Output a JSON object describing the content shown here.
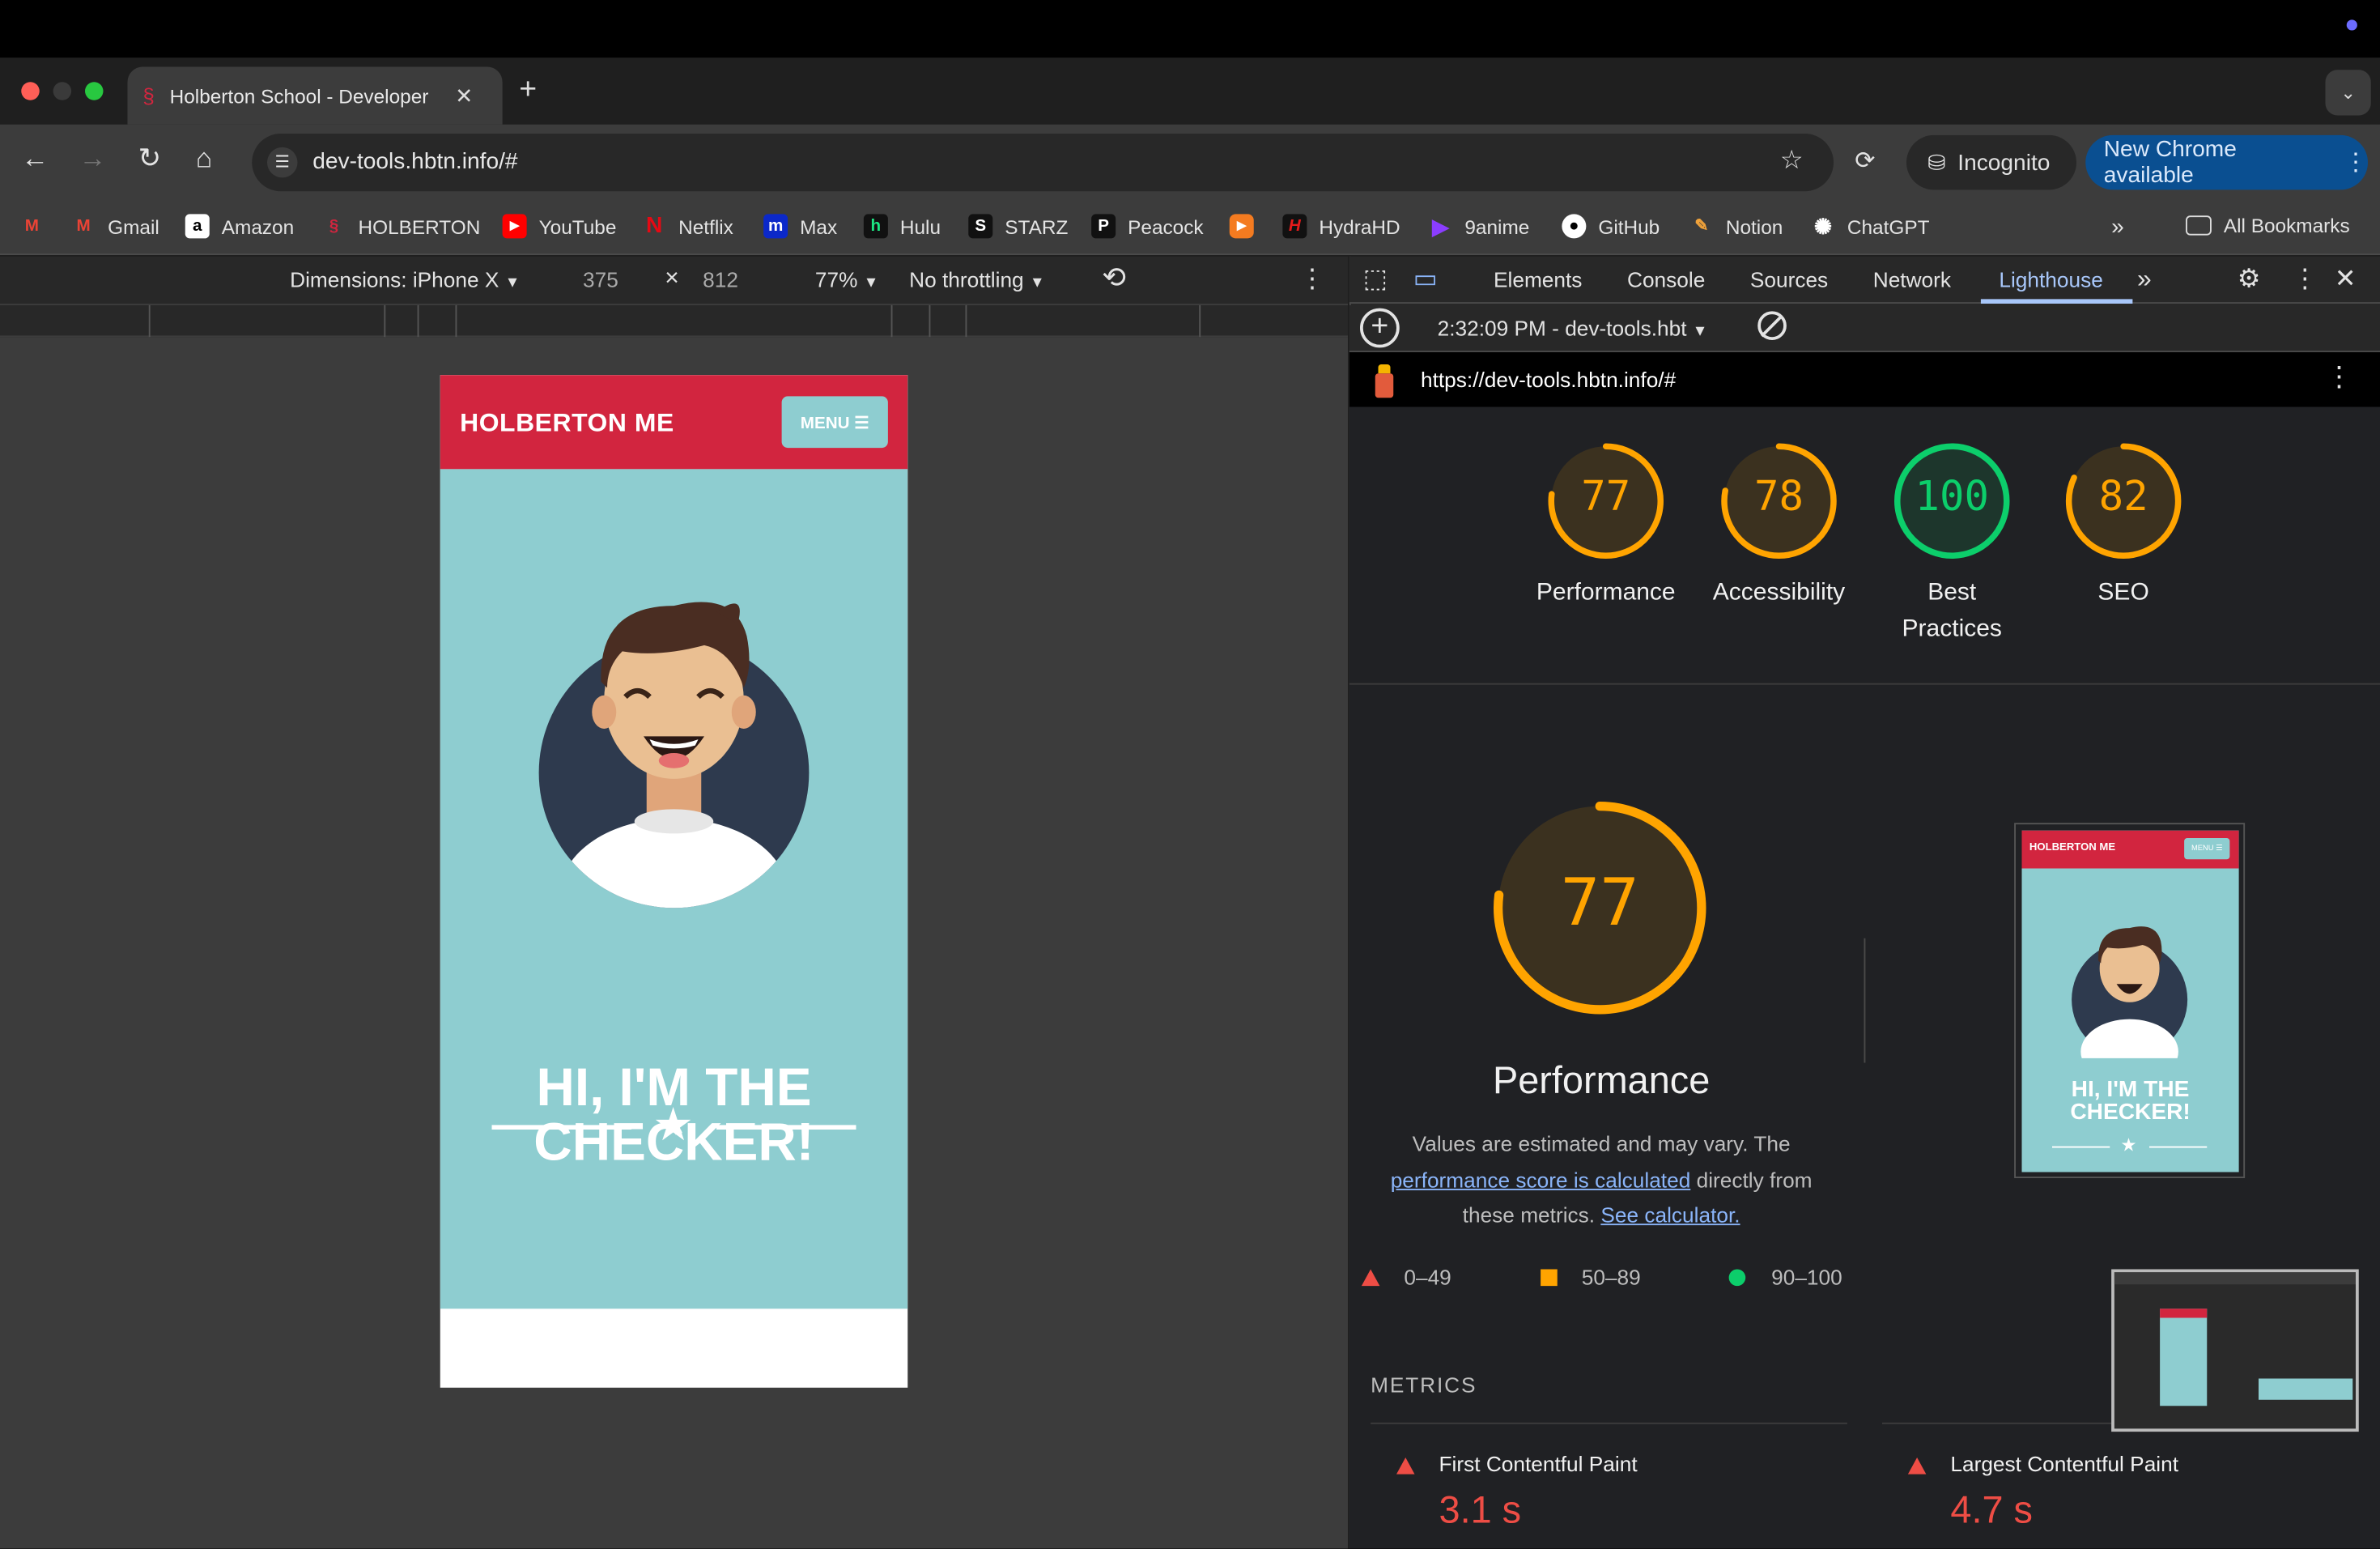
{
  "browser": {
    "tab_title": "Holberton School - Developer",
    "url": "dev-tools.hbtn.info/#",
    "incognito_label": "Incognito",
    "update_label": "New Chrome available",
    "bookmarks": [
      {
        "label": "",
        "icon": "gmail-icon"
      },
      {
        "label": "Gmail",
        "icon": "gmail-icon"
      },
      {
        "label": "Amazon",
        "icon": "amazon-icon"
      },
      {
        "label": "HOLBERTON",
        "icon": "holberton-icon"
      },
      {
        "label": "YouTube",
        "icon": "youtube-icon"
      },
      {
        "label": "Netflix",
        "icon": "netflix-icon"
      },
      {
        "label": "Max",
        "icon": "max-icon"
      },
      {
        "label": "Hulu",
        "icon": "hulu-icon"
      },
      {
        "label": "STARZ",
        "icon": "starz-icon"
      },
      {
        "label": "Peacock",
        "icon": "peacock-icon"
      },
      {
        "label": "",
        "icon": "play-icon"
      },
      {
        "label": "HydraHD",
        "icon": "hydra-icon"
      },
      {
        "label": "9anime",
        "icon": "anime-icon"
      },
      {
        "label": "GitHub",
        "icon": "github-icon"
      },
      {
        "label": "Notion",
        "icon": "notion-icon"
      },
      {
        "label": "ChatGPT",
        "icon": "chatgpt-icon"
      }
    ],
    "all_bookmarks": "All Bookmarks"
  },
  "device_toolbar": {
    "dimensions": "Dimensions: iPhone X",
    "width": "375",
    "times": "×",
    "height": "812",
    "zoom": "77%",
    "throttling": "No throttling"
  },
  "page": {
    "logo": "HOLBERTON ME",
    "menu": "MENU ☰",
    "headline_1": "HI, I'M THE",
    "headline_2": "CHECKER!"
  },
  "devtools": {
    "tabs": [
      "Elements",
      "Console",
      "Sources",
      "Network",
      "Lighthouse"
    ],
    "active_tab": "Lighthouse",
    "report_select": "2:32:09 PM - dev-tools.hbt",
    "report_url": "https://dev-tools.hbtn.info/#"
  },
  "lighthouse": {
    "scores": [
      {
        "value": "77",
        "label": "Performance",
        "fraction": 0.77,
        "color": "#ffa400"
      },
      {
        "value": "78",
        "label": "Accessibility",
        "fraction": 0.78,
        "color": "#ffa400"
      },
      {
        "value": "100",
        "label": "Best Practices",
        "fraction": 1.0,
        "color": "#0cce6b"
      },
      {
        "value": "82",
        "label": "SEO",
        "fraction": 0.82,
        "color": "#ffa400"
      }
    ],
    "perf_big_value": "77",
    "perf_big_label": "Performance",
    "desc_1": "Values are estimated and may vary. The ",
    "desc_link1": "performance score is calculated",
    "desc_2": " directly from these metrics. ",
    "desc_link2": "See calculator.",
    "legend": [
      "0–49",
      "50–89",
      "90–100"
    ],
    "metrics_heading": "METRICS",
    "metrics": [
      {
        "name": "First Contentful Paint",
        "value": "3.1 s"
      },
      {
        "name": "Largest Contentful Paint",
        "value": "4.7 s"
      }
    ],
    "thumb_logo": "HOLBERTON ME",
    "thumb_menu": "MENU ☰",
    "thumb_headline_1": "HI, I'M THE",
    "thumb_headline_2": "CHECKER!"
  },
  "colors": {
    "accent_red": "#d2253f",
    "page_teal": "#8ecdd0",
    "chrome_blue": "#0a4f91"
  }
}
